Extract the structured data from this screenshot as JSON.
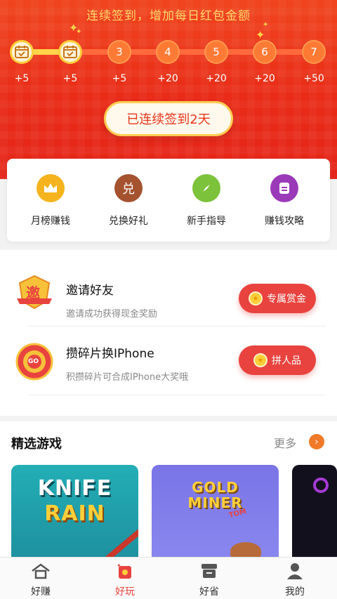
{
  "header": {
    "title": "连续签到，增加每日红包金额",
    "days": [
      {
        "label": "",
        "reward": "+5",
        "done": true
      },
      {
        "label": "",
        "reward": "+5",
        "done": true
      },
      {
        "label": "3",
        "reward": "+5",
        "done": false
      },
      {
        "label": "4",
        "reward": "+20",
        "done": false
      },
      {
        "label": "5",
        "reward": "+20",
        "done": false
      },
      {
        "label": "6",
        "reward": "+20",
        "done": false
      },
      {
        "label": "7",
        "reward": "+50",
        "done": false
      }
    ],
    "checked_button": "已连续签到2天"
  },
  "menu": [
    {
      "label": "月榜赚钱",
      "icon": "crown-icon",
      "color": "#f5b41e"
    },
    {
      "label": "兑换好礼",
      "icon": "exchange-icon",
      "glyph": "兑",
      "color": "#a5522f"
    },
    {
      "label": "新手指导",
      "icon": "compass-icon",
      "color": "#7cc23a"
    },
    {
      "label": "赚钱攻略",
      "icon": "document-icon",
      "color": "#9b3ab8"
    }
  ],
  "tasks": [
    {
      "title": "邀请好友",
      "subtitle": "邀请成功获得现金奖励",
      "button": "专属赏金",
      "icon": "invite-badge-icon",
      "badge_text": "邀"
    },
    {
      "title": "攒碎片换IPhone",
      "subtitle": "积攒碎片可合成IPhone大奖哦",
      "button": "拼人品",
      "icon": "lucky-wheel-icon",
      "badge_text": "GO"
    }
  ],
  "games": {
    "title": "精选游戏",
    "more": "更多",
    "items": [
      {
        "line1": "KNIFE",
        "line2": "RAIN"
      },
      {
        "line1": "GOLD",
        "line2": "MINER",
        "tag": "TOM"
      }
    ]
  },
  "tabs": [
    {
      "label": "好赚",
      "icon": "house-icon",
      "active": false
    },
    {
      "label": "好玩",
      "icon": "red-packet-icon",
      "active": true
    },
    {
      "label": "好省",
      "icon": "store-icon",
      "active": false
    },
    {
      "label": "我的",
      "icon": "person-icon",
      "active": false
    }
  ],
  "colors": {
    "brand_red": "#e8433f",
    "header_red": "#e92b17",
    "gold": "#ffd44a"
  }
}
